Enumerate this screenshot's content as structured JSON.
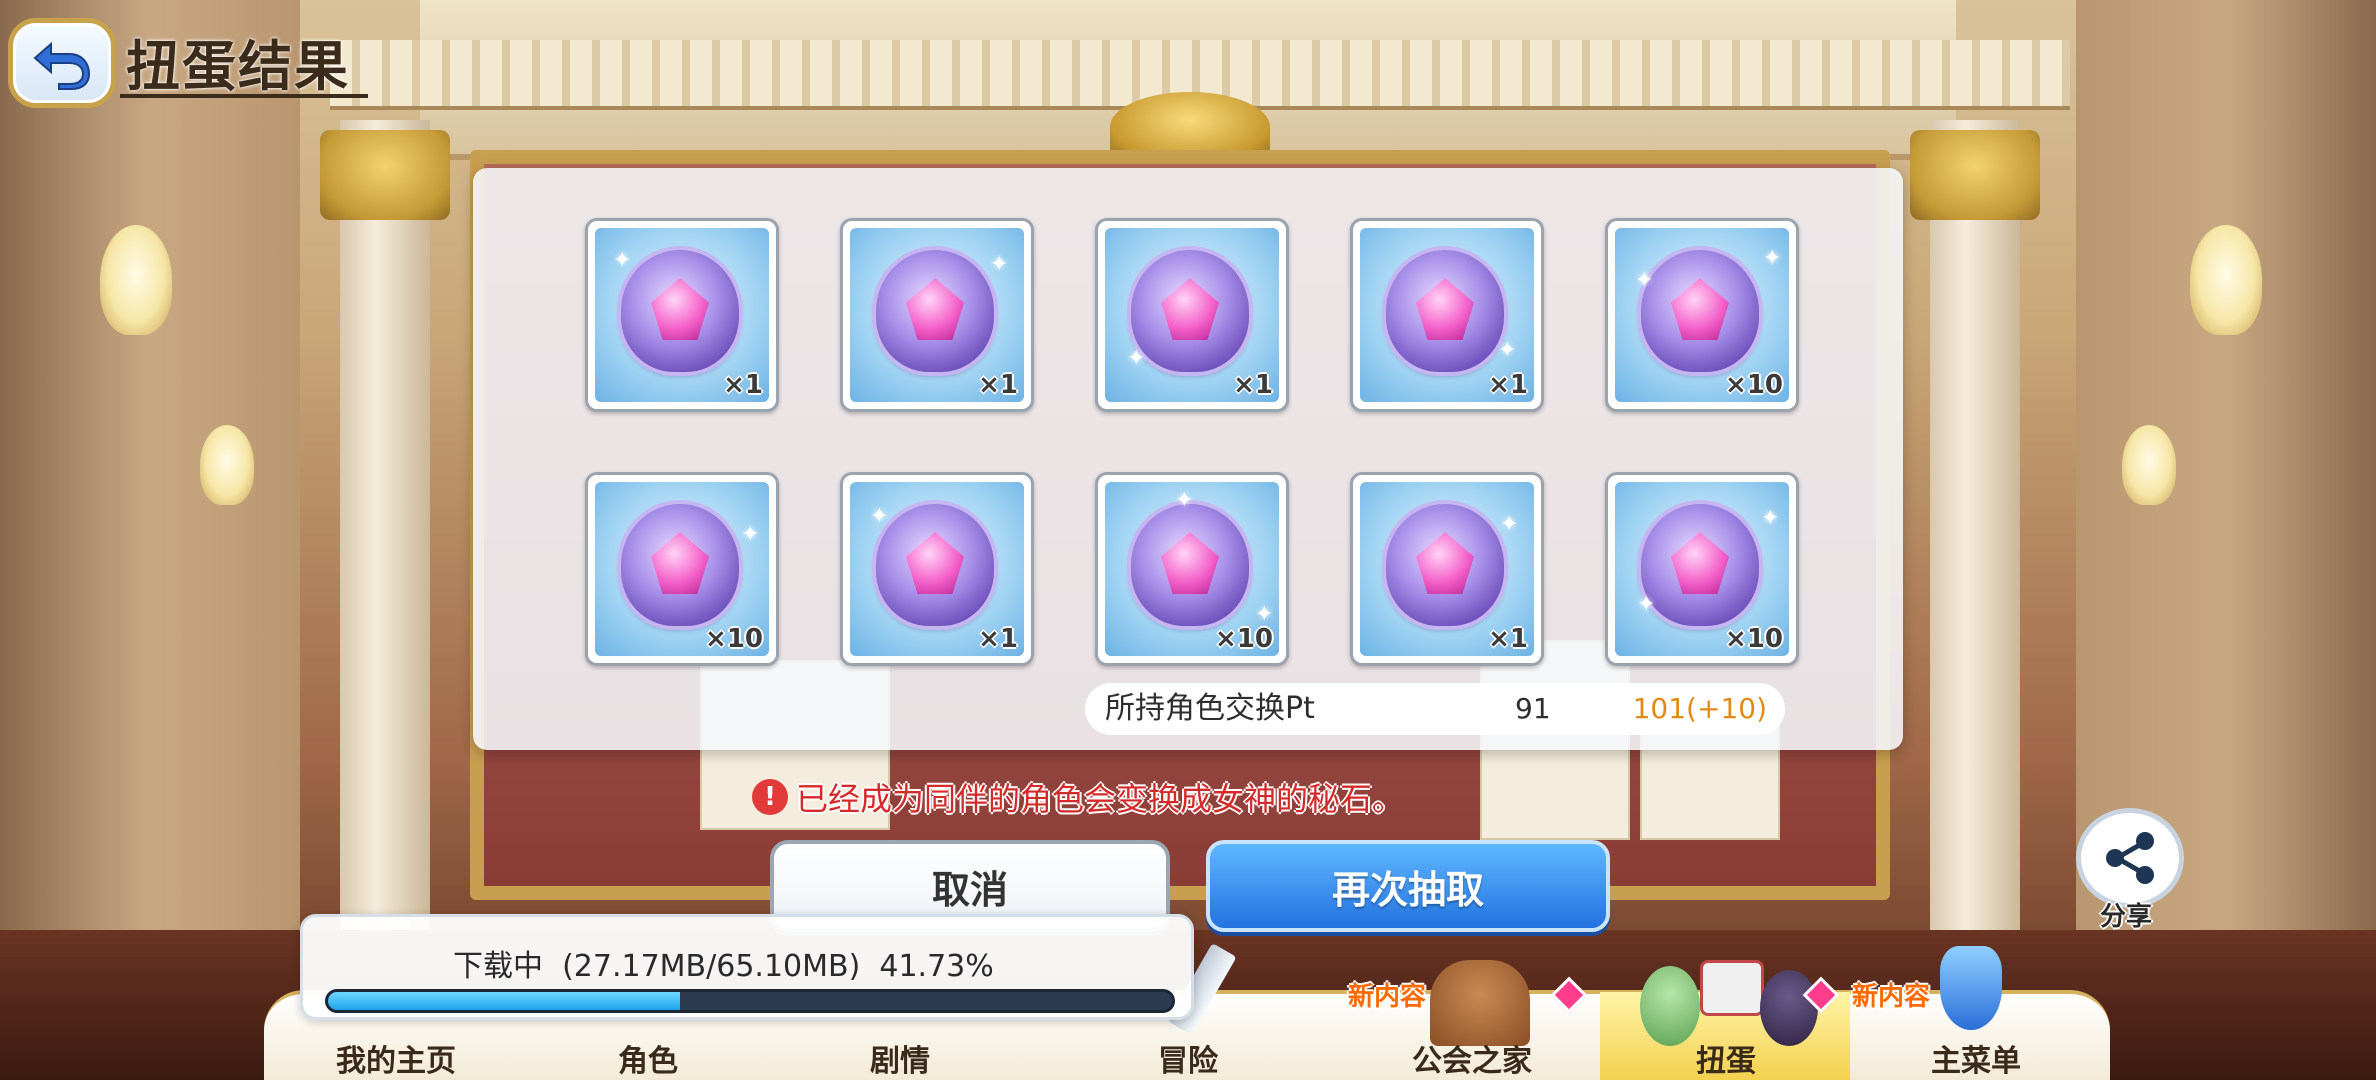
{
  "header": {
    "title": "扭蛋结果"
  },
  "results": {
    "items": [
      {
        "qty": "×1"
      },
      {
        "qty": "×1"
      },
      {
        "qty": "×1"
      },
      {
        "qty": "×1"
      },
      {
        "qty": "×10"
      },
      {
        "qty": "×10"
      },
      {
        "qty": "×1"
      },
      {
        "qty": "×10"
      },
      {
        "qty": "×1"
      },
      {
        "qty": "×10"
      }
    ],
    "item_icon": "goddess-stone-icon",
    "exchange_pt": {
      "label": "所持角色交换Pt",
      "current": "91",
      "after": "101(+10)"
    }
  },
  "warning": {
    "text": "已经成为同伴的角色会变换成女神的秘石。"
  },
  "actions": {
    "cancel_label": "取消",
    "draw_again_label": "再次抽取"
  },
  "share": {
    "label": "分享"
  },
  "download": {
    "text": "下载中  (27.17MB/65.10MB)  41.73%",
    "progress": 0.4173
  },
  "nav": {
    "items": [
      {
        "label": "我的主页"
      },
      {
        "label": "角色"
      },
      {
        "label": "剧情"
      },
      {
        "label": "冒险"
      },
      {
        "label": "公会之家",
        "badge": "新内容"
      },
      {
        "label": "扭蛋",
        "active": true
      },
      {
        "label": "主菜单",
        "badge": "新内容"
      }
    ]
  },
  "colors": {
    "accent_blue": "#2373e0",
    "warning_red": "#d62a2a",
    "pt_orange": "#e28a16",
    "progress": "#1ca3ea"
  }
}
